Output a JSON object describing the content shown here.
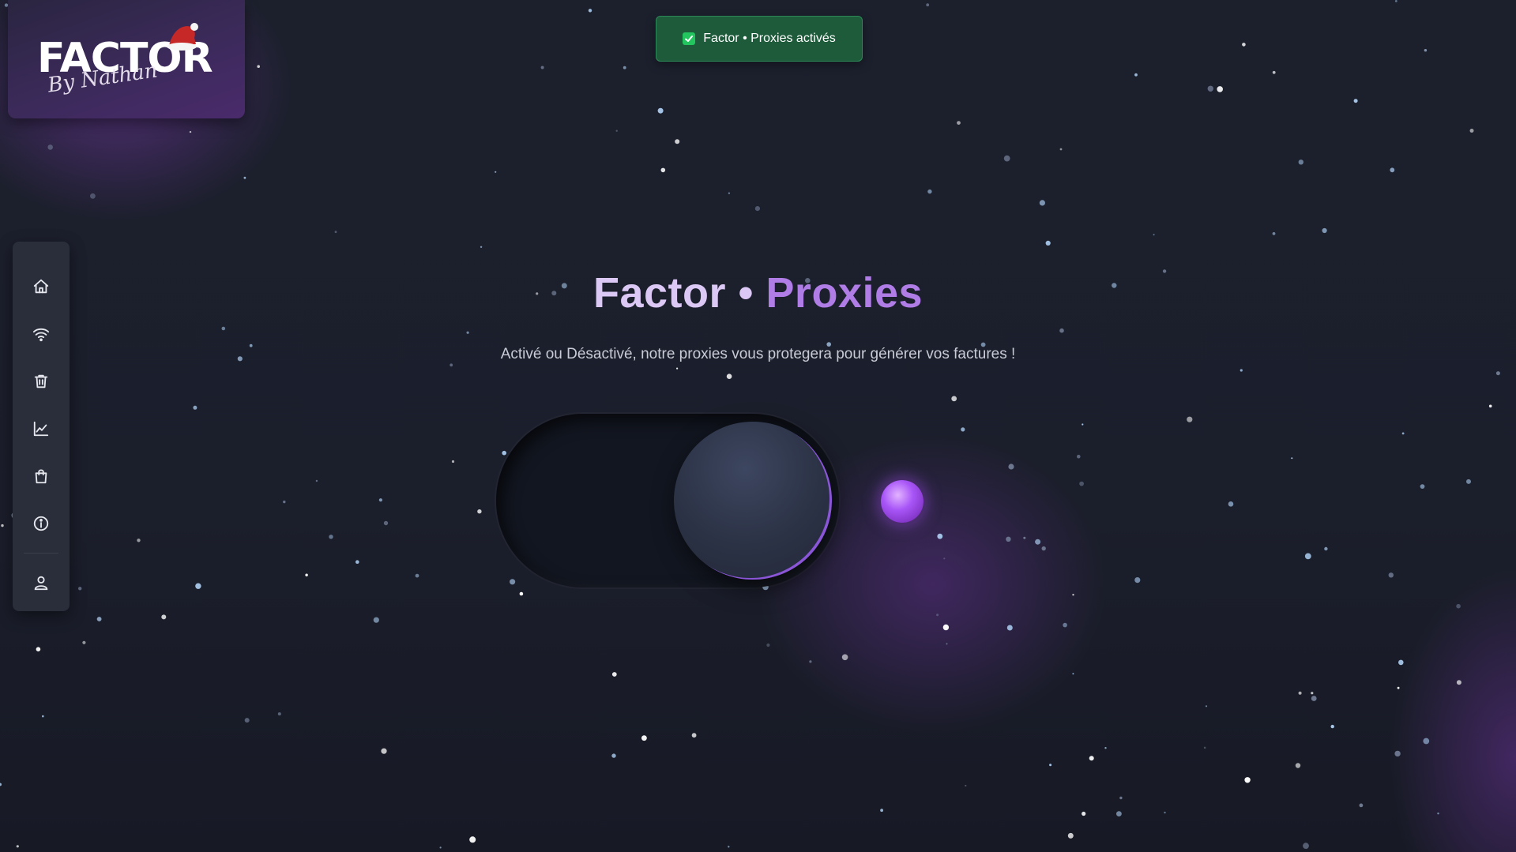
{
  "brand": {
    "logo_text": "FACTOR",
    "signature_text": "By Nathan"
  },
  "toast": {
    "message": "Factor • Proxies activés",
    "status_color": "#22c55e"
  },
  "sidebar": {
    "items": [
      {
        "icon": "home-icon",
        "name": "nav-home"
      },
      {
        "icon": "wifi-icon",
        "name": "nav-proxies"
      },
      {
        "icon": "trash-icon",
        "name": "nav-trash"
      },
      {
        "icon": "chart-icon",
        "name": "nav-stats"
      },
      {
        "icon": "bag-icon",
        "name": "nav-shop"
      },
      {
        "icon": "info-icon",
        "name": "nav-info"
      },
      {
        "icon": "user-icon",
        "name": "nav-account"
      }
    ]
  },
  "hero": {
    "title_part1": "Factor • ",
    "title_part2": "Proxies",
    "subtitle": "Activé ou Désactivé, notre proxies vous protegera pour générer vos factures !"
  },
  "toggle": {
    "state": "on"
  },
  "colors": {
    "accent": "#a855f7",
    "background": "#1b1f2c",
    "toast_bg": "#1d5b3a"
  }
}
